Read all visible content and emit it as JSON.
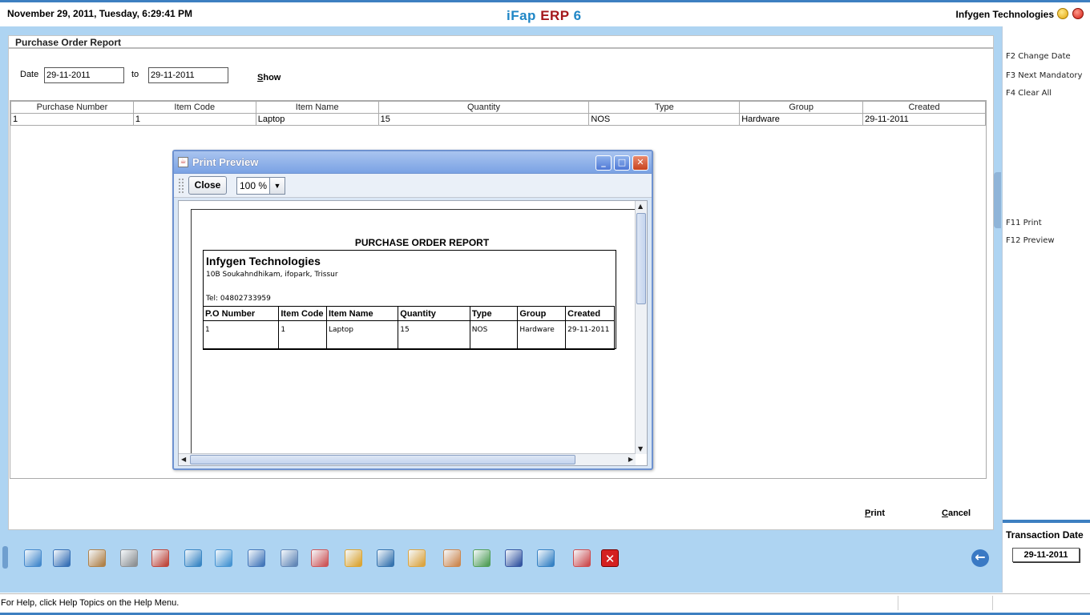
{
  "header": {
    "datetime": "November  29, 2011, Tuesday, 6:29:41 PM",
    "app_title_a": "iFap",
    "app_title_b": "ERP",
    "app_title_c": "6",
    "company": "Infygen Technologies"
  },
  "panel": {
    "title": "Purchase Order Report",
    "date_label": "Date",
    "date_from": "29-11-2011",
    "to_label": "to",
    "date_to": "29-11-2011",
    "show_label": "Show",
    "print_label": "Print",
    "cancel_label": "Cancel"
  },
  "grid": {
    "columns": [
      "Purchase Number",
      "Item Code",
      "Item Name",
      "Quantity",
      "Type",
      "Group",
      "Created"
    ],
    "rows": [
      [
        "1",
        "1",
        "Laptop",
        "15",
        "NOS",
        "Hardware",
        "29-11-2011"
      ]
    ]
  },
  "shortcuts": [
    {
      "label": "F2 Change Date"
    },
    {
      "label": "F3 Next Mandatory"
    },
    {
      "label": "F4 Clear All"
    },
    {
      "label": "F11 Print"
    },
    {
      "label": "F12 Preview"
    }
  ],
  "transaction": {
    "label": "Transaction Date",
    "value": "29-11-2011"
  },
  "toolbar_icons": [
    {
      "name": "map-icon",
      "color": "#3b83c9"
    },
    {
      "name": "user-phone-icon",
      "color": "#2c67b0"
    },
    {
      "name": "users-icon",
      "color": "#b07a3a"
    },
    {
      "name": "dots-icon",
      "color": "#8a8a8a"
    },
    {
      "name": "books-icon",
      "color": "#c0392b"
    },
    {
      "name": "cart-icon",
      "color": "#2f7fc0"
    },
    {
      "name": "transfer-icon",
      "color": "#3d8fd0"
    },
    {
      "name": "window-icon",
      "color": "#3a6fb5"
    },
    {
      "name": "report-icon",
      "color": "#5a7fb0"
    },
    {
      "name": "chart-icon",
      "color": "#d04a4a"
    },
    {
      "name": "tree-icon",
      "color": "#e0a020"
    },
    {
      "name": "users-group-icon",
      "color": "#2a6aa8"
    },
    {
      "name": "box-icon",
      "color": "#e0a030"
    },
    {
      "name": "clock-icon",
      "color": "#d08040"
    },
    {
      "name": "spreadsheet-icon",
      "color": "#4a9a4a"
    },
    {
      "name": "save-icon",
      "color": "#2a4a9a"
    },
    {
      "name": "gear-icon",
      "color": "#2a7ac0"
    },
    {
      "name": "calendar-icon",
      "color": "#d04040"
    },
    {
      "name": "exit-icon",
      "color": "#d42020"
    }
  ],
  "status": {
    "text": "For Help, click Help Topics on the Help Menu."
  },
  "dialog": {
    "title": "Print Preview",
    "close_label": "Close",
    "zoom": "100 %",
    "report": {
      "title": "PURCHASE ORDER REPORT",
      "company": "Infygen Technologies",
      "address": "10B Soukahndhikam, ifopark, Trissur",
      "tel": "Tel: 04802733959",
      "columns": [
        "P.O Number",
        "Item Code",
        "Item Name",
        "Quantity",
        "Type",
        "Group",
        "Created"
      ],
      "rows": [
        [
          "1",
          "1",
          "Laptop",
          "15",
          "NOS",
          "Hardware",
          "29-11-2011"
        ]
      ]
    }
  }
}
